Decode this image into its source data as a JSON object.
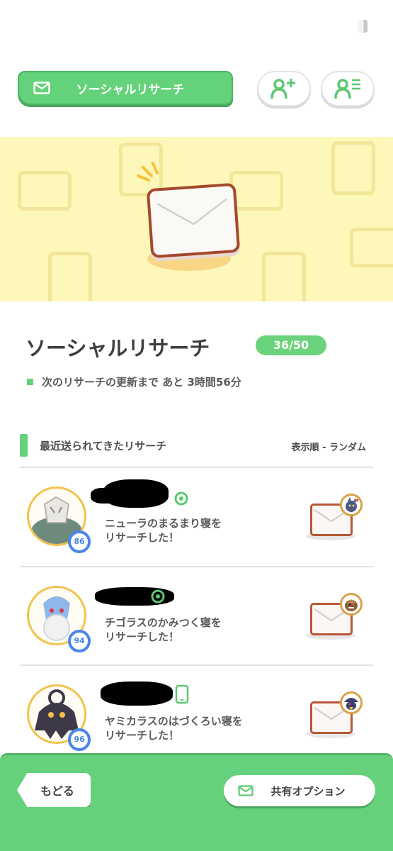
{
  "header": {
    "title": "ソーシャルリサーチ",
    "icons": [
      "mail-icon",
      "add-friend-icon",
      "friend-list-icon"
    ]
  },
  "main": {
    "title": "ソーシャルリサーチ",
    "count": "36/50",
    "update_text": "次のリサーチの更新まで あと 3時間56分"
  },
  "section": {
    "heading": "最近送られてきたリサーチ",
    "sort_label": "表示順 - ランダム"
  },
  "researches": [
    {
      "level": "86",
      "message_line1": "ニューラのまるまり寝を",
      "message_line2": "リサーチした！",
      "device_icon": "pokeball-plus-icon"
    },
    {
      "level": "94",
      "message_line1": "チゴラスのかみつく寝を",
      "message_line2": "リサーチした！",
      "device_icon": "pokeball-plus-icon"
    },
    {
      "level": "96",
      "message_line1": "ヤミカラスのはづくろい寝を",
      "message_line2": "リサーチした！",
      "device_icon": "smartphone-icon"
    }
  ],
  "footer": {
    "back_label": "もどる",
    "share_label": "共有オプション"
  },
  "colors": {
    "accent_green": "#64d27a",
    "banner_yellow": "#fdf7b9",
    "level_blue": "#4a86e8",
    "envelope_brown": "#a4482e"
  }
}
